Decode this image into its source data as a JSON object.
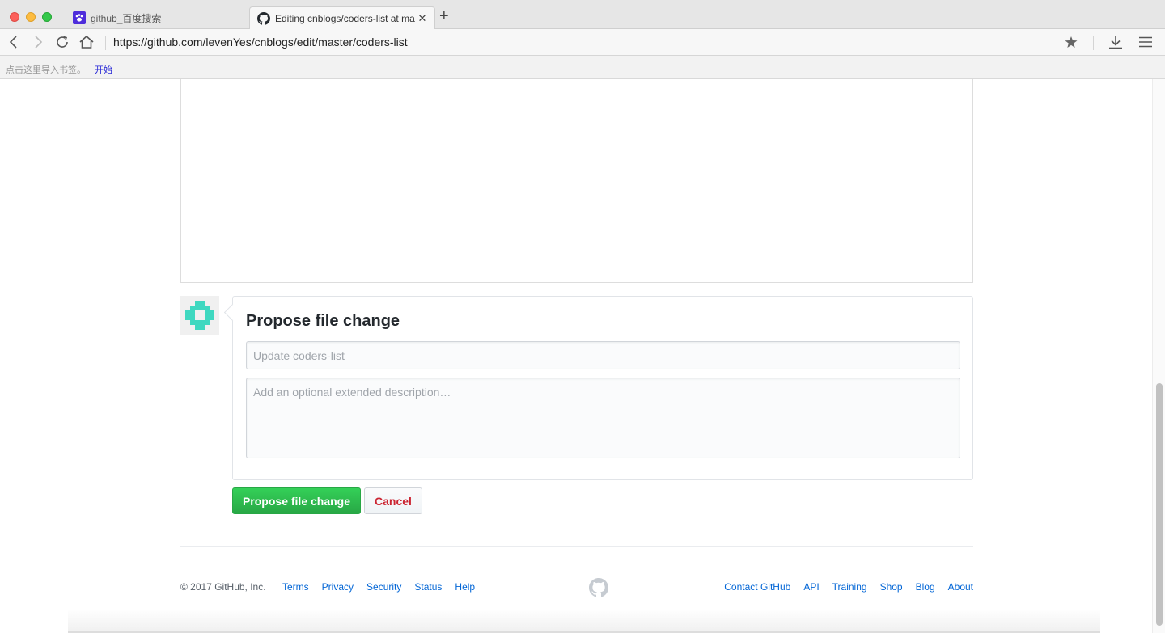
{
  "browser": {
    "tabs": [
      {
        "title": "github_百度搜索",
        "icon": "baidu-paw-icon",
        "active": false
      },
      {
        "title": "Editing cnblogs/coders-list at master · levenYes/cnblogs",
        "icon": "github-icon",
        "active": true
      }
    ],
    "url": "https://github.com/levenYes/cnblogs/edit/master/coders-list",
    "bookmarks": {
      "hint": "点击这里导入书签。",
      "items": [
        "开始"
      ]
    }
  },
  "commit": {
    "title": "Propose file change",
    "summary_placeholder": "Update coders-list",
    "description_placeholder": "Add an optional extended description…",
    "propose_label": "Propose file change",
    "cancel_label": "Cancel"
  },
  "footer": {
    "copyright": "© 2017 GitHub, Inc.",
    "left_links": [
      "Terms",
      "Privacy",
      "Security",
      "Status",
      "Help"
    ],
    "right_links": [
      "Contact GitHub",
      "API",
      "Training",
      "Shop",
      "Blog",
      "About"
    ]
  },
  "colors": {
    "primary_button": "#28a745",
    "cancel_text": "#cb2431",
    "link": "#0366d6",
    "avatar": "#3fd8c0"
  }
}
